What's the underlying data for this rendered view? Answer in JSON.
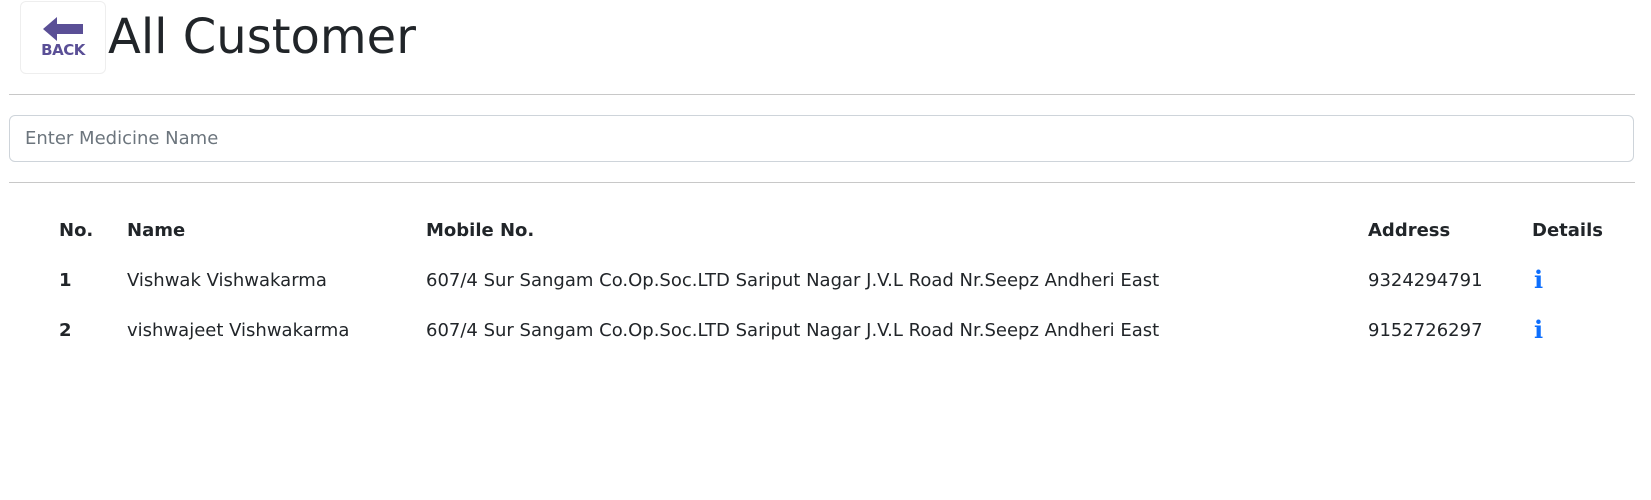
{
  "header": {
    "back_label": "BACK",
    "title": "All Customer"
  },
  "search": {
    "placeholder": "Enter Medicine Name",
    "value": ""
  },
  "table": {
    "columns": [
      "No.",
      "Name",
      "Mobile No.",
      "Address",
      "Details"
    ],
    "rows": [
      {
        "no": "1",
        "name": "Vishwak Vishwakarma",
        "mobile": "607/4 Sur Sangam Co.Op.Soc.LTD Sariput Nagar J.V.L Road Nr.Seepz Andheri East",
        "address": "9324294791",
        "details_icon": "info-icon"
      },
      {
        "no": "2",
        "name": "vishwajeet Vishwakarma",
        "mobile": "607/4 Sur Sangam Co.Op.Soc.LTD Sariput Nagar J.V.L Road Nr.Seepz Andheri East",
        "address": "9152726297",
        "details_icon": "info-icon"
      }
    ]
  },
  "colors": {
    "back_accent": "#5a4f96",
    "link": "#0d6efd",
    "text": "#212529",
    "placeholder": "#6c757d",
    "divider": "#c8c8c8"
  }
}
